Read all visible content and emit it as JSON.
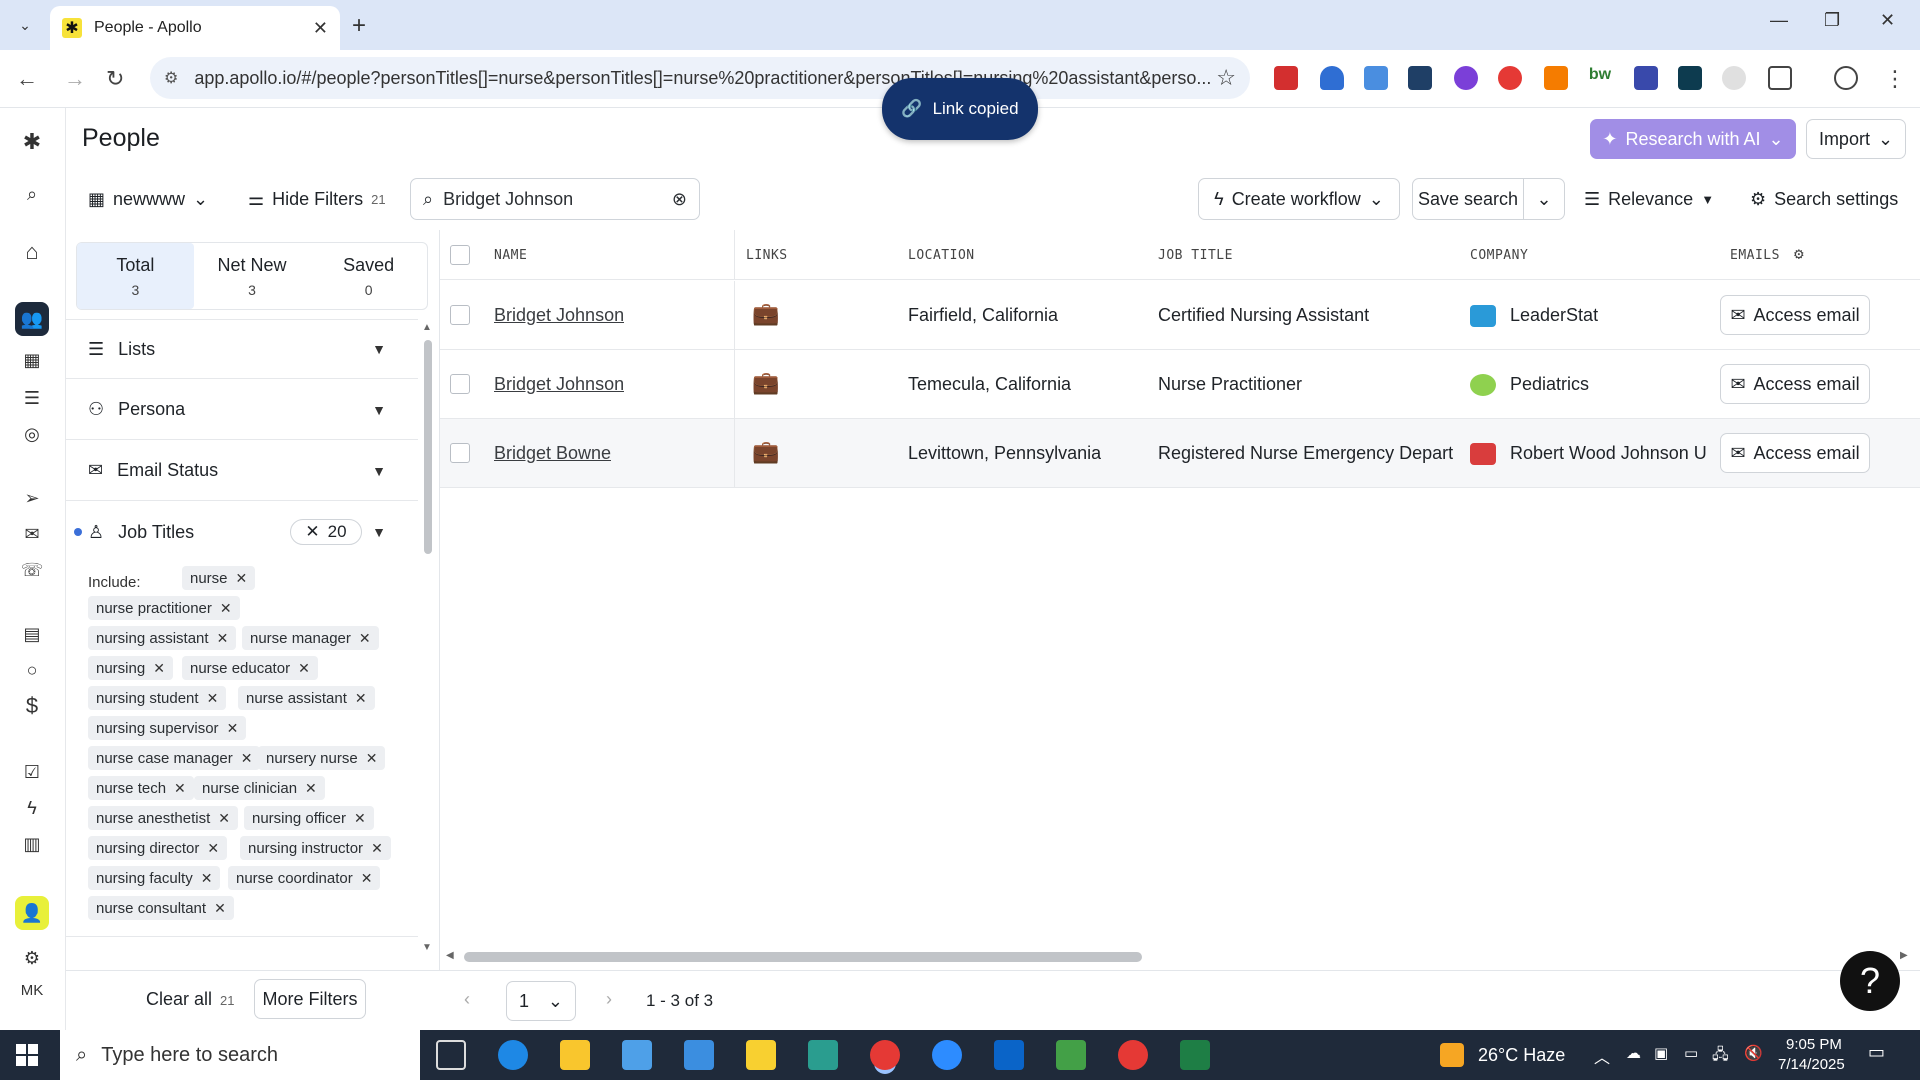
{
  "browser": {
    "tab_title": "People - Apollo",
    "url": "app.apollo.io/#/people?personTitles[]=nurse&personTitles[]=nurse%20practitioner&personTitles[]=nursing%20assistant&perso..."
  },
  "toast": {
    "text": "Link copied"
  },
  "header": {
    "title": "People",
    "research_ai": "Research with AI",
    "import": "Import"
  },
  "toolbar": {
    "view_name": "newwww",
    "hide_filters": "Hide Filters",
    "filter_count": "21",
    "search_value": "Bridget Johnson",
    "create_workflow": "Create workflow",
    "save_search": "Save search",
    "sort": "Relevance",
    "search_settings": "Search settings"
  },
  "summary": {
    "total_label": "Total",
    "total_value": "3",
    "netnew_label": "Net New",
    "netnew_value": "3",
    "saved_label": "Saved",
    "saved_value": "0"
  },
  "filters": {
    "lists": "Lists",
    "persona": "Persona",
    "email_status": "Email Status",
    "job_titles": "Job Titles",
    "job_titles_count": "20",
    "include_label": "Include:",
    "chips": [
      "nurse",
      "nurse practitioner",
      "nursing assistant",
      "nurse manager",
      "nursing",
      "nurse educator",
      "nursing student",
      "nurse assistant",
      "nursing supervisor",
      "nurse case manager",
      "nursery nurse",
      "nurse tech",
      "nurse clinician",
      "nurse anesthetist",
      "nursing officer",
      "nursing director",
      "nursing instructor",
      "nursing faculty",
      "nurse coordinator",
      "nurse consultant"
    ],
    "clear_all": "Clear all",
    "clear_count": "21",
    "more_filters": "More Filters"
  },
  "table": {
    "headers": [
      "NAME",
      "LINKS",
      "LOCATION",
      "JOB TITLE",
      "COMPANY",
      "EMAILS"
    ],
    "rows": [
      {
        "name": "Bridget Johnson",
        "location": "Fairfield, California",
        "title": "Certified Nursing Assistant",
        "company": "LeaderStat",
        "email_btn": "Access email",
        "logo_color": "#2a9ad8"
      },
      {
        "name": "Bridget Johnson",
        "location": "Temecula, California",
        "title": "Nurse Practitioner",
        "company": "Pediatrics",
        "email_btn": "Access email",
        "logo_color": "#8fd14f"
      },
      {
        "name": "Bridget Bowne",
        "location": "Levittown, Pennsylvania",
        "title": "Registered Nurse Emergency Departm",
        "company": "Robert Wood Johnson U",
        "email_btn": "Access email",
        "logo_color": "#d93d3d"
      }
    ]
  },
  "pager": {
    "page": "1",
    "range": "1 - 3 of 3"
  },
  "rail": {
    "avatar_initials": "MK"
  },
  "taskbar": {
    "search_placeholder": "Type here to search",
    "weather": "26°C  Haze",
    "time": "9:05 PM",
    "date": "7/14/2025"
  },
  "colors": {
    "accent_ai": "#a18ee6",
    "toast_bg": "#14336c",
    "rail_active": "#1d2a3c"
  }
}
